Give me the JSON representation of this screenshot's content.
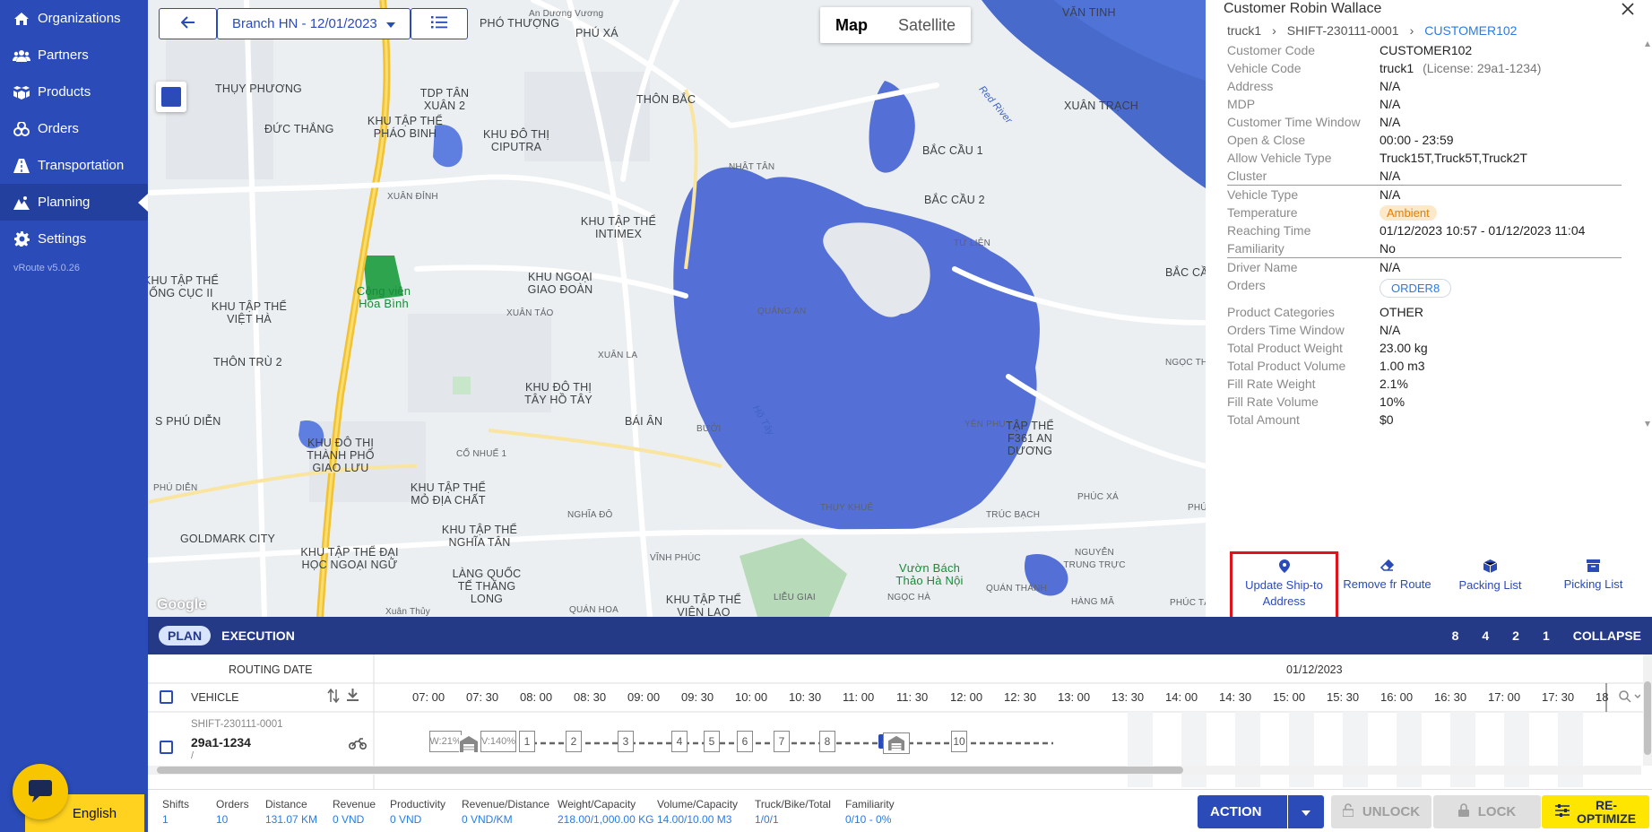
{
  "app": {
    "version": "vRoute v5.0.26",
    "language": "English"
  },
  "sidebar": {
    "items": [
      {
        "label": "Organizations",
        "icon": "home-icon"
      },
      {
        "label": "Partners",
        "icon": "users-icon"
      },
      {
        "label": "Products",
        "icon": "boxes-icon"
      },
      {
        "label": "Orders",
        "icon": "orders-icon"
      },
      {
        "label": "Transportation",
        "icon": "road-icon"
      },
      {
        "label": "Planning",
        "icon": "planning-icon",
        "active": true
      },
      {
        "label": "Settings",
        "icon": "gear-icon"
      }
    ]
  },
  "map": {
    "branch_select": "Branch HN - 12/01/2023",
    "map_type": {
      "map": "Map",
      "satellite": "Satellite",
      "selected": "Map"
    },
    "attribution": "Google",
    "labels": [
      "PHÓ THƯỢNG",
      "PHÚ XÁ",
      "VĂN TINH",
      "An Dương Vương",
      "THỤY PHƯƠNG",
      "TDP TÂN XUÂN 2",
      "KHU TẬP THỂ PHÁO BINH",
      "THÔN BẮC",
      "XUÂN TRẠCH",
      "ĐỨC THẮNG",
      "KHU ĐÔ THỊ CIPUTRA",
      "NHẬT TÂN",
      "BẮC CẦU 1",
      "XUÂN ĐỈNH",
      "BẮC CẦU 2",
      "KHU TẬP THỂ INTIMEX",
      "TỨ LIÊN",
      "KHU NGOẠI GIAO ĐOÀN",
      "Công viên Hòa Bình",
      "BẮC CẦ",
      "KHU TẬP THỂ ỐNG CỤC II",
      "KHU TẬP THỂ VIỆT HÀ",
      "XUÂN TẢO",
      "QUẢNG AN",
      "THÔN TRÙ 2",
      "XUÂN LA",
      "NGỌC TH",
      "KHU ĐÔ THỊ TÂY HỒ TÂY",
      "S PHÚ DIỄN",
      "BÁI ÂN",
      "BƯỞI",
      "Hồ Tây",
      "YÊN PHỤ",
      "KHU ĐÔ THỊ THÀNH PHỐ GIAO LƯU",
      "TẬP THỂ F361 AN DƯƠNG",
      "CỔ NHUẾ 1",
      "PHÚ DIỄN",
      "KHU TẬP THỂ MỎ ĐỊA CHẤT",
      "PHÚC XÁ",
      "THỤY KHUÊ",
      "PHÚC TÂN",
      "TRÚC BẠCH",
      "NGHĨA ĐÔ",
      "KHU TẬP THỂ NGHĨA TÂN",
      "GOLDMARK CITY",
      "NGUYỄN TRUNG TRỰC",
      "KHU TẬP THỂ ĐẠI HỌC NGOẠI NGỮ",
      "LÀNG QUỐC TẾ THĂNG LONG",
      "VĨNH PHÚC",
      "Vườn Bách Thảo Hà Nội",
      "QUÁN THÁNH",
      "HÀNG MÃ",
      "PHÚC TÂN",
      "NGỌC HÀ",
      "LIỄU GIAI",
      "KHU TẬP THỂ VIỆN LAO",
      "QUÁN HOA",
      "Red River",
      "Xuân Thủy"
    ]
  },
  "panel": {
    "title": "Customer Robin Wallace",
    "breadcrumb": [
      "truck1",
      "SHIFT-230111-0001",
      "CUSTOMER102"
    ],
    "fields": [
      {
        "k": "Customer Code",
        "v": "CUSTOMER102"
      },
      {
        "k": "Vehicle Code",
        "v": "truck1",
        "extra": "(License: 29a1-1234)"
      },
      {
        "k": "Address",
        "v": "N/A"
      },
      {
        "k": "MDP",
        "v": "N/A"
      },
      {
        "k": "Customer Time Window",
        "v": "N/A"
      },
      {
        "k": "Open & Close",
        "v": "00:00 - 23:59"
      },
      {
        "k": "Allow Vehicle Type",
        "v": "Truck15T,Truck5T,Truck2T"
      },
      {
        "k": "Cluster",
        "v": "N/A"
      }
    ],
    "fields2": [
      {
        "k": "Vehicle Type",
        "v": "N/A"
      },
      {
        "k": "Temperature",
        "v": "Ambient"
      },
      {
        "k": "Reaching Time",
        "v": "01/12/2023 10:57 - 01/12/2023 11:04"
      },
      {
        "k": "Familiarity",
        "v": "No"
      }
    ],
    "fields3": [
      {
        "k": "Driver Name",
        "v": "N/A"
      },
      {
        "k": "Orders",
        "v": "ORDER8"
      }
    ],
    "fields4": [
      {
        "k": "Product Categories",
        "v": "OTHER"
      },
      {
        "k": "Orders Time Window",
        "v": "N/A"
      },
      {
        "k": "Total Product Weight",
        "v": "23.00 kg"
      },
      {
        "k": "Total Product Volume",
        "v": "1.00 m3"
      },
      {
        "k": "Fill Rate Weight",
        "v": "2.1%"
      },
      {
        "k": "Fill Rate Volume",
        "v": "10%"
      },
      {
        "k": "Total Amount",
        "v": "$0"
      }
    ],
    "actions": [
      {
        "label": "Update Ship-to Address",
        "icon": "map-pin-icon"
      },
      {
        "label": "Remove fr Route",
        "icon": "eraser-icon"
      },
      {
        "label": "Packing List",
        "icon": "package-icon"
      },
      {
        "label": "Picking List",
        "icon": "archive-icon"
      }
    ]
  },
  "bottom": {
    "tabs": {
      "plan": "PLAN",
      "execution": "EXECUTION"
    },
    "zoom_levels": [
      "8",
      "4",
      "2",
      "1"
    ],
    "collapse": "COLLAPSE",
    "routing_date_label": "ROUTING DATE",
    "date": "01/12/2023",
    "vehicle_label": "VEHICLE",
    "times": [
      "07: 00",
      "07: 30",
      "08: 00",
      "08: 30",
      "09: 00",
      "09: 30",
      "10: 00",
      "10: 30",
      "11: 00",
      "11: 30",
      "12: 00",
      "12: 30",
      "13: 00",
      "13: 30",
      "14: 00",
      "14: 30",
      "15: 00",
      "15: 30",
      "16: 00",
      "16: 30",
      "17: 00",
      "17: 30",
      "18"
    ],
    "row": {
      "shift": "SHIFT-230111-0001",
      "plate": "29a1-1234",
      "sub": "/",
      "weight_fill": "W:21%",
      "volume_fill": "V:140%",
      "stops": [
        "1",
        "2",
        "3",
        "4",
        "5",
        "6",
        "7",
        "8",
        "9",
        "10"
      ]
    }
  },
  "summary": [
    {
      "k": "Shifts",
      "v": "1"
    },
    {
      "k": "Orders",
      "v": "10"
    },
    {
      "k": "Distance",
      "v": "131.07 KM"
    },
    {
      "k": "Revenue",
      "v": "0 VND"
    },
    {
      "k": "Productivity",
      "v": "0 VND"
    },
    {
      "k": "Revenue/Distance",
      "v": "0 VND/KM"
    },
    {
      "k": "Weight/Capacity",
      "v": "218.00/1,000.00 KG"
    },
    {
      "k": "Volume/Capacity",
      "v": "14.00/10.00 M3"
    },
    {
      "k": "Truck/Bike/Total",
      "v": "1/0/1"
    },
    {
      "k": "Familiarity",
      "v": "0/10 - 0%"
    }
  ],
  "buttons": {
    "action": "ACTION",
    "unlock": "UNLOCK",
    "lock": "LOCK",
    "reoptimize": "RE-\nOPTIMIZE"
  },
  "colors": {
    "sidebar": "#2a4bb8",
    "accent": "#2a7be4",
    "bar": "#253a86",
    "highlight": "#e0121c",
    "reoptimize": "#ffe600"
  }
}
